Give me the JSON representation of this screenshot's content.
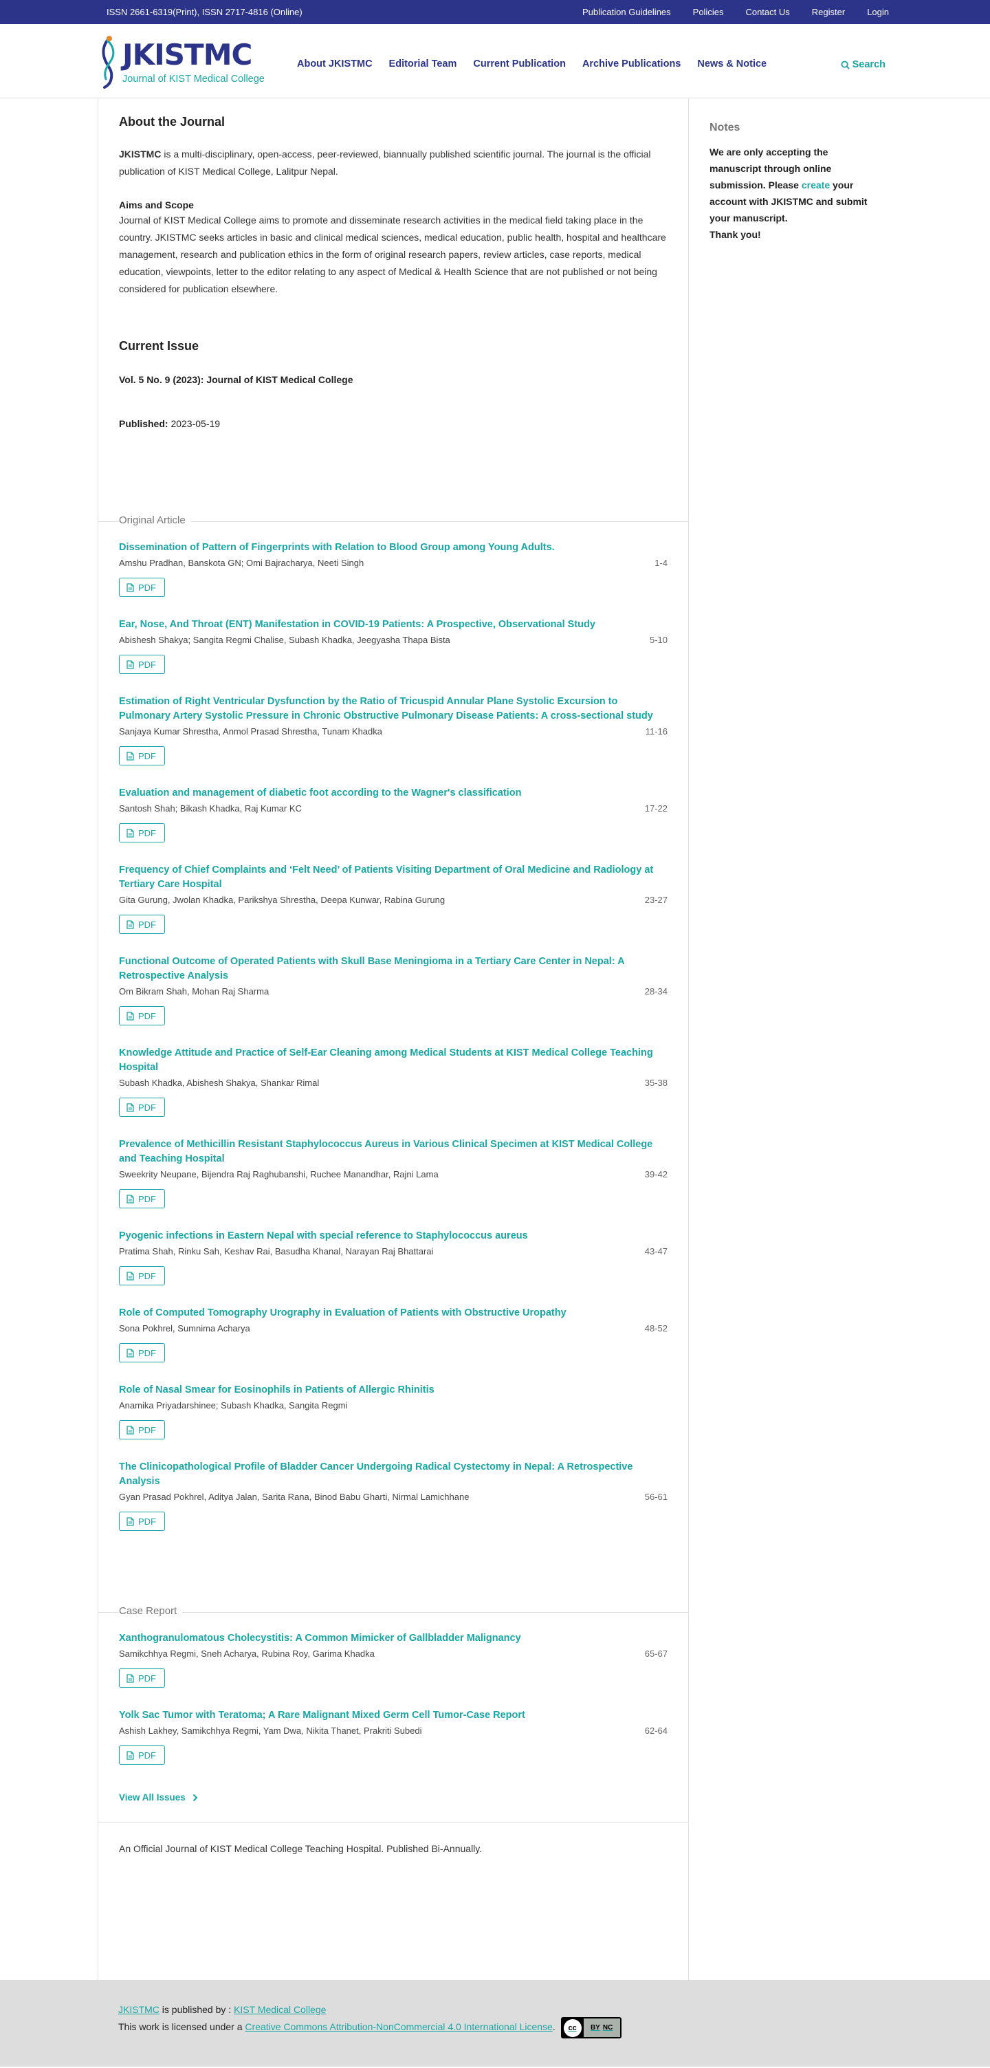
{
  "topbar": {
    "issn": "ISSN 2661-6319(Print), ISSN 2717-4816 (Online)",
    "links": [
      "Publication Guidelines",
      "Policies",
      "Contact Us",
      "Register",
      "Login"
    ]
  },
  "logo": {
    "title": "JKISTMC",
    "subtitle": "Journal of KIST Medical College"
  },
  "nav": {
    "items": [
      "About JKISTMC",
      "Editorial Team",
      "Current Publication",
      "Archive Publications",
      "News & Notice"
    ],
    "search": "Search"
  },
  "about": {
    "heading": "About the Journal",
    "lead_bold": "JKISTMC",
    "lead_text": " is a multi-disciplinary, open-access, peer-reviewed, biannually published scientific journal. The journal is the official publication of KIST Medical College, Lalitpur Nepal.",
    "scope_title": "Aims and Scope",
    "scope_text": " Journal of KIST Medical College aims to promote and disseminate research activities in the medical field taking place in the country. JKISTMC seeks articles in basic and clinical medical sciences, medical education, public health, hospital and healthcare management, research and publication ethics in the form of  original research papers, review articles, case reports, medical education, viewpoints, letter to the editor relating to any aspect of Medical & Health Science that are not published or not being considered for publication elsewhere."
  },
  "current": {
    "heading": "Current Issue",
    "issue_title": "Vol. 5 No. 9 (2023): Journal of KIST Medical College",
    "published_label": "Published:",
    "published_date": "2023-05-19"
  },
  "sections": [
    {
      "title": "Original Article",
      "articles": [
        {
          "title": "Dissemination of Pattern of Fingerprints with Relation to Blood Group among Young Adults.",
          "authors": "Amshu Pradhan, Banskota GN; Omi Bajracharya, Neeti Singh",
          "pages": "1-4",
          "pdf": "PDF"
        },
        {
          "title": "Ear, Nose, And Throat (ENT) Manifestation in COVID-19 Patients: A Prospective, Observational Study",
          "authors": "Abishesh Shakya; Sangita Regmi Chalise, Subash Khadka, Jeegyasha Thapa Bista",
          "pages": "5-10",
          "pdf": "PDF"
        },
        {
          "title": "Estimation of Right Ventricular Dysfunction by the Ratio of Tricuspid Annular Plane Systolic Excursion to Pulmonary Artery Systolic Pressure in Chronic Obstructive Pulmonary Disease Patients: A cross-sectional study",
          "authors": "Sanjaya Kumar Shrestha, Anmol Prasad Shrestha, Tunam Khadka",
          "pages": "11-16",
          "pdf": "PDF"
        },
        {
          "title": "Evaluation and management of diabetic foot according to the Wagner's classification",
          "authors": "Santosh Shah; Bikash Khadka, Raj Kumar KC",
          "pages": "17-22",
          "pdf": "PDF"
        },
        {
          "title": "Frequency of Chief Complaints and ‘Felt Need’ of Patients Visiting Department of Oral Medicine and Radiology at Tertiary Care Hospital",
          "authors": "Gita Gurung, Jwolan Khadka, Parikshya Shrestha, Deepa Kunwar, Rabina Gurung",
          "pages": "23-27",
          "pdf": "PDF"
        },
        {
          "title": "Functional Outcome of Operated Patients with Skull Base Meningioma in a Tertiary Care Center in Nepal: A Retrospective Analysis",
          "authors": "Om Bikram Shah, Mohan Raj Sharma",
          "pages": "28-34",
          "pdf": "PDF"
        },
        {
          "title": "Knowledge Attitude and Practice of Self-Ear Cleaning among Medical Students at KIST Medical College Teaching Hospital",
          "authors": "Subash Khadka, Abishesh Shakya, Shankar Rimal",
          "pages": "35-38",
          "pdf": "PDF"
        },
        {
          "title": "Prevalence of Methicillin Resistant Staphylococcus Aureus in Various Clinical Specimen at KIST Medical College and Teaching Hospital",
          "authors": "Sweekrity Neupane, Bijendra Raj Raghubanshi, Ruchee Manandhar, Rajni Lama",
          "pages": "39-42",
          "pdf": "PDF"
        },
        {
          "title": "Pyogenic infections in Eastern Nepal with special reference to Staphylococcus aureus",
          "authors": "Pratima Shah, Rinku Sah, Keshav Rai, Basudha Khanal, Narayan Raj Bhattarai",
          "pages": "43-47",
          "pdf": "PDF"
        },
        {
          "title": "Role of Computed Tomography Urography in Evaluation of Patients with Obstructive Uropathy",
          "authors": "Sona Pokhrel, Sumnima Acharya",
          "pages": "48-52",
          "pdf": "PDF"
        },
        {
          "title": "Role of Nasal Smear for Eosinophils in Patients of Allergic Rhinitis",
          "authors": "Anamika Priyadarshinee; Subash Khadka, Sangita Regmi",
          "pages": "",
          "pdf": "PDF"
        },
        {
          "title": "The Clinicopathological Profile of Bladder Cancer Undergoing Radical Cystectomy in Nepal: A Retrospective Analysis",
          "authors": "Gyan Prasad Pokhrel, Aditya Jalan, Sarita Rana, Binod Babu Gharti, Nirmal Lamichhane",
          "pages": "56-61",
          "pdf": "PDF"
        }
      ]
    },
    {
      "title": "Case Report",
      "articles": [
        {
          "title": "Xanthogranulomatous Cholecystitis: A Common Mimicker of Gallbladder Malignancy",
          "authors": "Samikchhya Regmi, Sneh Acharya, Rubina Roy, Garima Khadka",
          "pages": "65-67",
          "pdf": "PDF"
        },
        {
          "title": "Yolk Sac Tumor with Teratoma; A Rare Malignant Mixed Germ Cell Tumor-Case Report",
          "authors": "Ashish Lakhey, Samikchhya Regmi, Yam Dwa, Nikita Thanet, Prakriti Subedi",
          "pages": "62-64",
          "pdf": "PDF"
        }
      ]
    }
  ],
  "view_all": "View All Issues",
  "footer_note": "An Official Journal of KIST Medical College Teaching Hospital. Published Bi-Annually.",
  "notes": {
    "heading": "Notes",
    "text_before": "We are only accepting the manuscript through online submission. Please ",
    "link": "create",
    "text_after": " your account with JKISTMC and submit your manuscript.",
    "thanks": "Thank you!"
  },
  "sitefoot": {
    "journal_link": "JKISTMC",
    "published_by": " is published by : ",
    "publisher_link": "KIST Medical College",
    "license_prefix": "This work is licensed under a ",
    "license_link": "Creative Commons Attribution-NonCommercial 4.0 International License",
    "license_suffix": ".",
    "badge_cc": "cc",
    "badge_terms": [
      "BY",
      "NC"
    ]
  },
  "colors": {
    "brand": "#2b3488",
    "accent": "#1aa6a4",
    "footer_bg": "#dddddd"
  }
}
